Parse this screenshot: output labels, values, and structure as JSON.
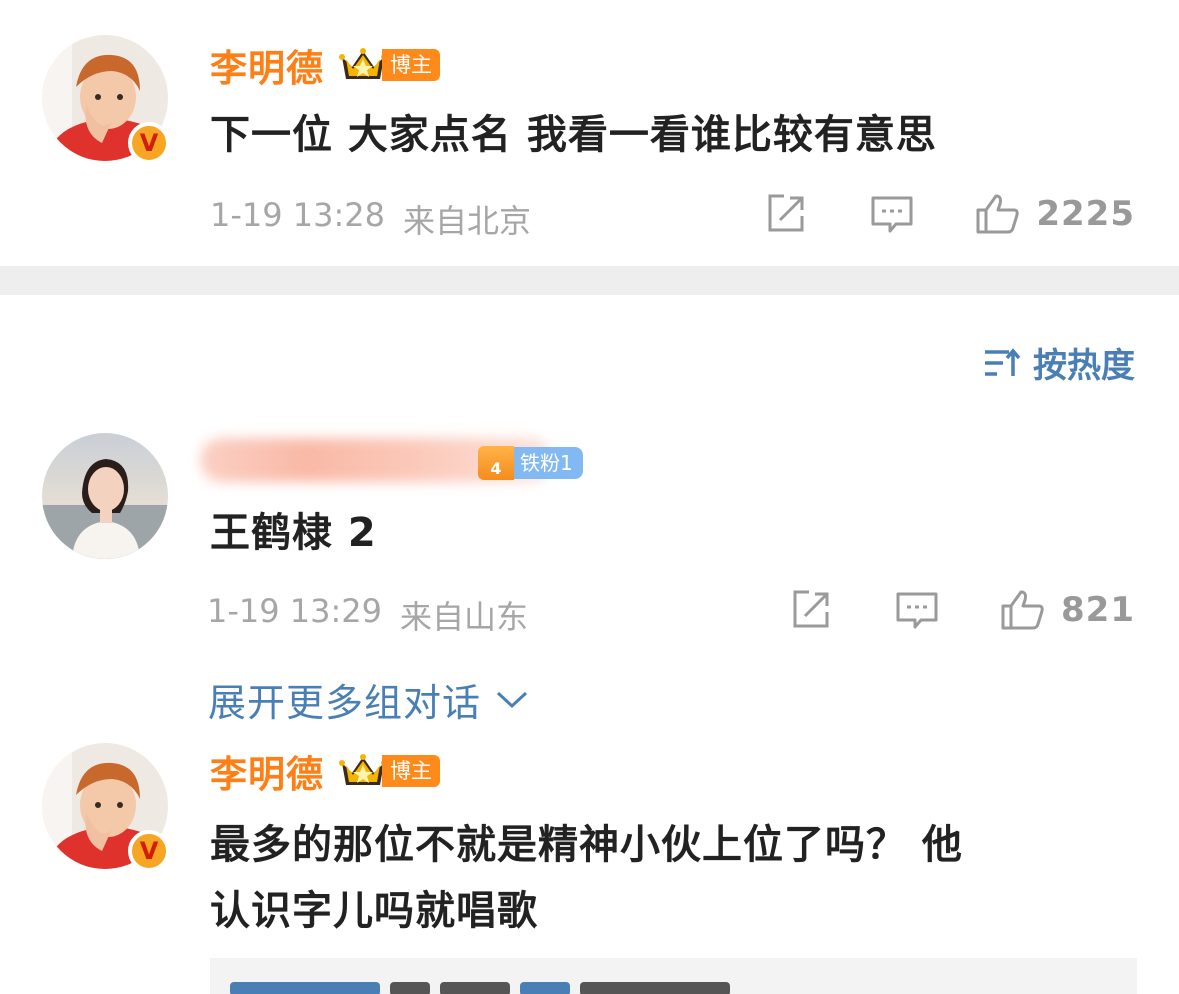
{
  "post1": {
    "author": "李明德",
    "badge": "博主",
    "text": "下一位 大家点名 我看一看谁比较有意思",
    "time": "1-19 13:28",
    "location": "来自北京",
    "likes": "2225"
  },
  "sort": {
    "label": "按热度"
  },
  "comment1": {
    "fan_badge": "铁粉1",
    "fan_level": "4",
    "text": "王鹤棣 2",
    "time": "1-19 13:29",
    "location": "来自山东",
    "likes": "821"
  },
  "expand": {
    "label": "展开更多组对话"
  },
  "comment2": {
    "author": "李明德",
    "badge": "博主",
    "text_line1": "最多的那位不就是精神小伙上位了吗？ 他",
    "text_line2": "认识字儿吗就唱歌"
  },
  "colors": {
    "name_orange": "#ff7f17",
    "link_blue": "#4a7fb5",
    "meta_gray": "#a6a6a6",
    "divider": "#eeeeee"
  },
  "icons": [
    "verified-v-icon",
    "crown-icon",
    "share-icon",
    "comment-icon",
    "like-icon",
    "sort-icon",
    "chevron-down-icon"
  ]
}
